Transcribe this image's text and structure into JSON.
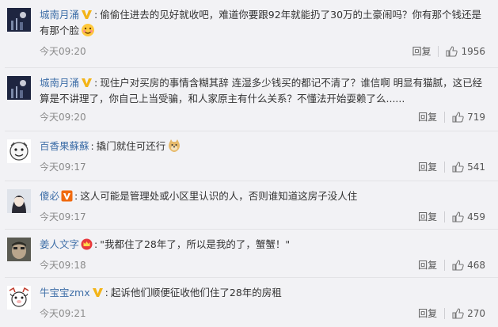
{
  "comments": [
    {
      "user": "城南月涌",
      "badge": "gold-v",
      "text": "偷偷住进去的见好就收吧，难道你要跟92年就能扔了30万的土豪闹吗？你有那个钱还是有那个脸",
      "emoji": "smile-emoji",
      "time": "今天09:20",
      "reply_label": "回复",
      "likes": "1956"
    },
    {
      "user": "城南月涌",
      "badge": "gold-v",
      "text": "现住户对买房的事情含糊其辞 连湿多少钱买的都记不清了？谁信啊 明显有猫腻，这已经算是不讲理了，你自己上当受骗，和人家原主有什么关系？不懂法开始耍赖了么......",
      "emoji": "",
      "time": "今天09:20",
      "reply_label": "回复",
      "likes": "719"
    },
    {
      "user": "百香果蘇蘇",
      "badge": "",
      "text": "撬门就住可还行",
      "emoji": "doge-emoji",
      "time": "今天09:17",
      "reply_label": "回复",
      "likes": "541"
    },
    {
      "user": "傻必",
      "badge": "orange-v",
      "text": "这人可能是管理处或小区里认识的人，否则谁知道这房子没人住",
      "emoji": "",
      "time": "今天09:17",
      "reply_label": "回复",
      "likes": "459"
    },
    {
      "user": "姜人文字",
      "badge": "red-crown",
      "text": "\"我都住了28年了，所以是我的了，蟹蟹！\"",
      "emoji": "",
      "time": "今天09:18",
      "reply_label": "回复",
      "likes": "468"
    },
    {
      "user": "牛宝宝zmx",
      "badge": "gold-v",
      "text": "起诉他们顺便征收他们住了28年的房租",
      "emoji": "",
      "time": "今天09:21",
      "reply_label": "回复",
      "likes": "270"
    }
  ],
  "colors": {
    "username": "#3f6fa8",
    "gold_v": "#f3b418",
    "orange_v": "#f06a0f",
    "meta": "#8a8a8a"
  }
}
